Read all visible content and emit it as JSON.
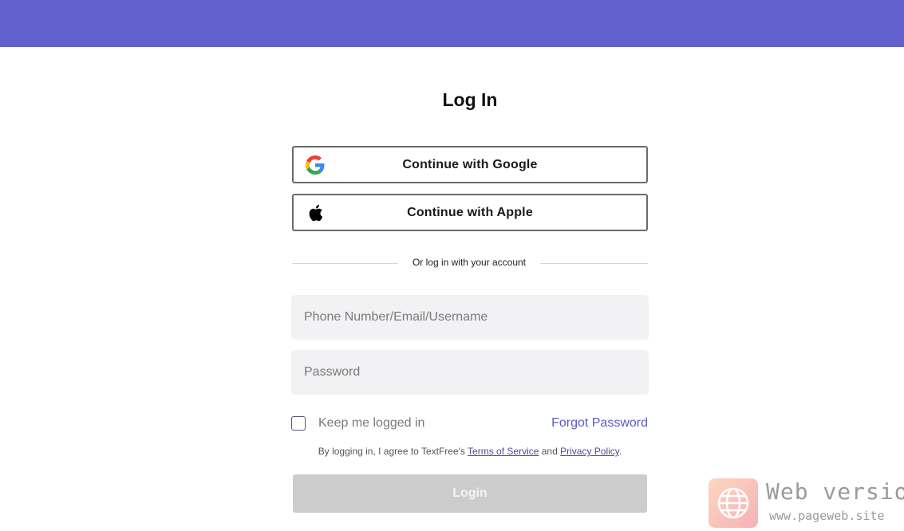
{
  "header": {
    "accent_color": "#6361cc"
  },
  "login": {
    "title": "Log In",
    "google_label": "Continue with Google",
    "apple_label": "Continue with Apple",
    "divider_text": "Or log in with your account",
    "username_placeholder": "Phone Number/Email/Username",
    "password_placeholder": "Password",
    "keep_logged_in": "Keep me logged in",
    "keep_logged_in_checked": false,
    "forgot_password": "Forgot Password",
    "terms_prefix": "By logging in, I agree to TextFree's ",
    "terms_link": "Terms of Service",
    "terms_and": " and ",
    "privacy_link": "Privacy Policy",
    "terms_suffix": ".",
    "login_button": "Login",
    "login_button_enabled": false
  },
  "icons": {
    "google": "google-icon",
    "apple": "apple-icon",
    "watermark": "globe-icon"
  },
  "watermark": {
    "title": "Web version",
    "url": "www.pageweb.site"
  }
}
